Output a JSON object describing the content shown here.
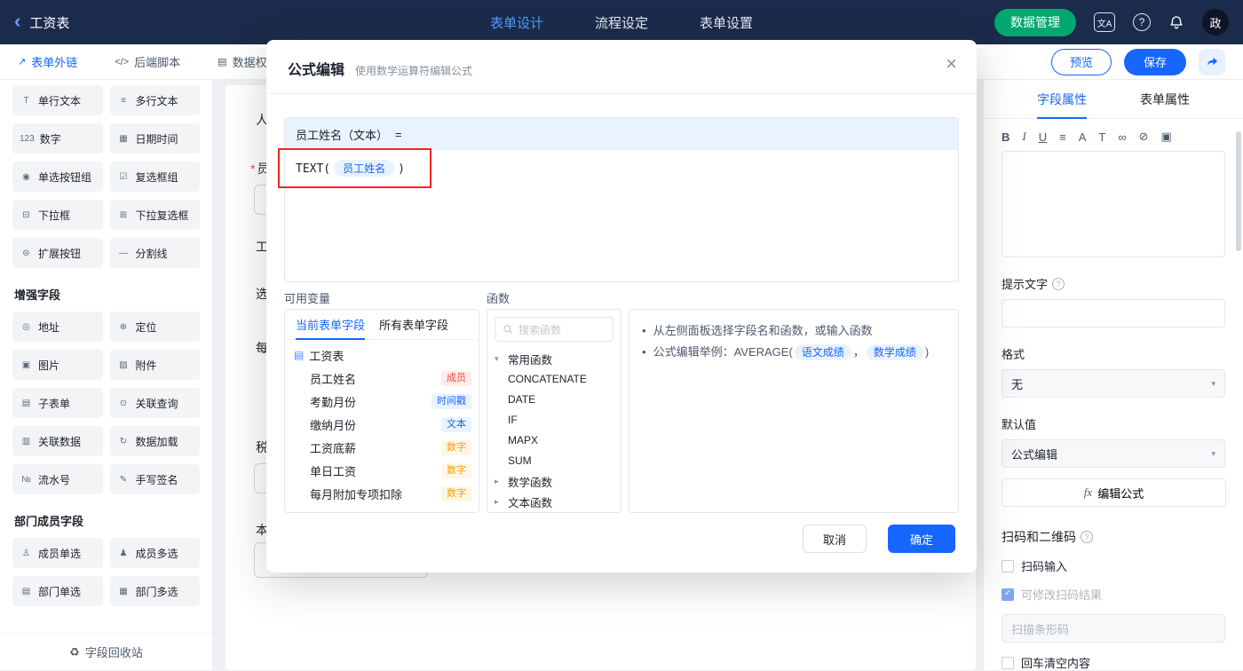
{
  "colors": {
    "primary": "#1766ff",
    "primary_light_bg": "#e8f3ff",
    "topbar_bg": "#1b2b4b",
    "green": "#00a870",
    "annotation_red": "#f2271c",
    "tag_member_fg": "#f54a45",
    "tag_member_bg": "#ffece8",
    "tag_time_fg": "#1766ff",
    "tag_time_bg": "#e8f3ff",
    "tag_number_fg": "#ff9d00",
    "tag_number_bg": "#fff7e6",
    "text_dark": "#1d2129",
    "text_mid": "#4e5969",
    "text_light": "#86909c",
    "border": "#e5e6eb"
  },
  "topbar": {
    "back_icon": "‹",
    "title": "工资表",
    "tabs": [
      {
        "label": "表单设计",
        "active": true
      },
      {
        "label": "流程设定",
        "active": false
      },
      {
        "label": "表单设置",
        "active": false
      }
    ],
    "data_manage_button": "数据管理",
    "lang_icon_text": "文A",
    "help_icon": "?",
    "avatar_text": "政"
  },
  "toolbar": {
    "items": [
      {
        "label": "表单外链",
        "icon": "↗",
        "active": true
      },
      {
        "label": "后端脚本",
        "icon": "</>",
        "active": false
      },
      {
        "label": "数据权",
        "icon": "▤",
        "active": false
      }
    ],
    "preview_button": "预览",
    "save_button": "保存"
  },
  "sidebar": {
    "groups": [
      {
        "title": "",
        "items": [
          {
            "label": "单行文本",
            "icon": "T"
          },
          {
            "label": "多行文本",
            "icon": "≡"
          },
          {
            "label": "数字",
            "icon": "123"
          },
          {
            "label": "日期时间",
            "icon": "▦"
          },
          {
            "label": "单选按钮组",
            "icon": "◉"
          },
          {
            "label": "复选框组",
            "icon": "☑"
          },
          {
            "label": "下拉框",
            "icon": "⊟"
          },
          {
            "label": "下拉复选框",
            "icon": "⊞"
          },
          {
            "label": "扩展按钮",
            "icon": "⊜"
          },
          {
            "label": "分割线",
            "icon": "—"
          }
        ]
      },
      {
        "title": "增强字段",
        "items": [
          {
            "label": "地址",
            "icon": "◎"
          },
          {
            "label": "定位",
            "icon": "⊕"
          },
          {
            "label": "图片",
            "icon": "▣"
          },
          {
            "label": "附件",
            "icon": "▨"
          },
          {
            "label": "子表单",
            "icon": "▤"
          },
          {
            "label": "关联查询",
            "icon": "⊙"
          },
          {
            "label": "关联数据",
            "icon": "▥"
          },
          {
            "label": "数据加载",
            "icon": "↻"
          },
          {
            "label": "流水号",
            "icon": "№"
          },
          {
            "label": "手写签名",
            "icon": "✎"
          }
        ]
      },
      {
        "title": "部门成员字段",
        "items": [
          {
            "label": "成员单选",
            "icon": "♙"
          },
          {
            "label": "成员多选",
            "icon": "♟"
          },
          {
            "label": "部门单选",
            "icon": "▤"
          },
          {
            "label": "部门多选",
            "icon": "▦"
          }
        ]
      }
    ],
    "recycle_icon": "♻",
    "recycle_bin": "字段回收站"
  },
  "canvas": {
    "required_mark": "*",
    "labels": [
      "人",
      "员",
      "工",
      "选",
      "每",
      "税",
      "本"
    ]
  },
  "modal": {
    "title": "公式编辑",
    "subtitle": "使用数学运算符编辑公式",
    "close_icon": "×",
    "target_field": "员工姓名（文本）",
    "equals": "=",
    "formula_function": "TEXT(",
    "formula_variable": "员工姓名",
    "formula_close": ")",
    "variables_label": "可用变量",
    "functions_label": "函数",
    "variables_panel": {
      "tabs": [
        {
          "label": "当前表单字段",
          "active": true
        },
        {
          "label": "所有表单字段",
          "active": false
        }
      ],
      "root_icon": "▤",
      "root": "工资表",
      "fields": [
        {
          "name": "员工姓名",
          "tag": "成员",
          "tag_type": "member"
        },
        {
          "name": "考勤月份",
          "tag": "时间戳",
          "tag_type": "time"
        },
        {
          "name": "缴纳月份",
          "tag": "文本",
          "tag_type": "text"
        },
        {
          "name": "工资底薪",
          "tag": "数字",
          "tag_type": "number"
        },
        {
          "name": "单日工资",
          "tag": "数字",
          "tag_type": "number"
        },
        {
          "name": "每月附加专项扣除",
          "tag": "数字",
          "tag_type": "number"
        }
      ]
    },
    "functions_panel": {
      "search_placeholder": "搜索函数",
      "group_common": {
        "icon": "▾",
        "name": "常用函数"
      },
      "common_items": [
        "CONCATENATE",
        "DATE",
        "IF",
        "MAPX",
        "SUM"
      ],
      "group_math": {
        "icon": "▸",
        "name": "数学函数"
      },
      "group_text": {
        "icon": "▸",
        "name": "文本函数"
      }
    },
    "help": {
      "bullet": "•",
      "tip1": "从左侧面板选择字段名和函数，或输入函数",
      "tip2_prefix": "公式编辑举例：AVERAGE(",
      "tip2_var1": "语文成绩",
      "tip2_separator": "，",
      "tip2_var2": "数学成绩",
      "tip2_suffix": ")"
    },
    "cancel_button": "取消",
    "confirm_button": "确定"
  },
  "properties": {
    "tabs": [
      {
        "label": "字段属性",
        "active": true
      },
      {
        "label": "表单属性",
        "active": false
      }
    ],
    "rich_toolbar": [
      "B",
      "I",
      "U",
      "≡",
      "A",
      "T",
      "∞",
      "⊘",
      "▣"
    ],
    "hint_label": "提示文字",
    "help_icon": "?",
    "format_label": "格式",
    "format_value": "无",
    "chevron_icon": "▾",
    "default_label": "默认值",
    "default_value": "公式编辑",
    "fx_icon": "fx",
    "edit_formula_button": "编辑公式",
    "scan_section_label": "扫码和二维码",
    "checkbox_scan": {
      "label": "扫码输入",
      "checked": false
    },
    "checkbox_modify": {
      "label": "可修改扫码结果",
      "checked": true,
      "disabled": true
    },
    "scan_input_placeholder": "扫描条形码",
    "checkbox_clear": {
      "label": "回车清空内容",
      "checked": false
    }
  }
}
